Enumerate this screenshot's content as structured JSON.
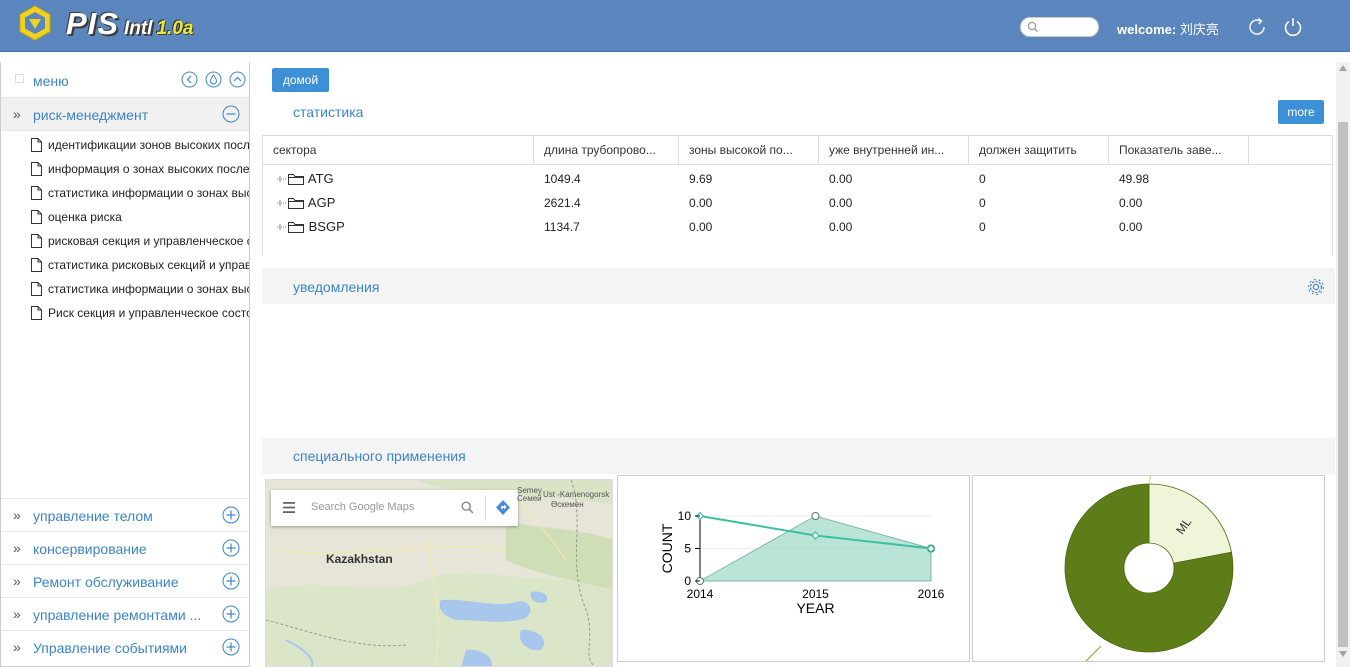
{
  "header": {
    "logo_main": "PIS",
    "logo_sub": "Intl",
    "logo_version": "1.0a",
    "search_placeholder": "",
    "welcome_label": "welcome:",
    "user_name": "刘庆亮",
    "brand_color": "#5b85bd"
  },
  "sidebar": {
    "menu_title": "меню",
    "risk_section": "риск-менеджмент",
    "risk_items": [
      "идентификации зонов высоких последствий",
      "информация о зонах высоких последствий",
      "статистика информации о зонах высоких последствий",
      "оценка риска",
      "рисковая секция и управленческое состояние",
      "статистика рисковых секций и управленческого состояния",
      "статистика информации о зонах высоких последствий",
      "Риск секция и управленческое состояние"
    ],
    "other_sections": [
      "управление телом",
      "консервирование",
      "Ремонт обслуживание",
      "управление ремонтами ...",
      "Управление событиями"
    ]
  },
  "main": {
    "home_button": "домой",
    "stats_title": "статистика",
    "more_button": "more",
    "table": {
      "columns": [
        "сектора",
        "длина трубопрово...",
        "зоны высокой по...",
        "уже внутренней ин...",
        "должен защитить",
        "Показатель заве..."
      ],
      "rows": [
        [
          "ATG",
          "1049.4",
          "9.69",
          "0.00",
          "0",
          "49.98"
        ],
        [
          "AGP",
          "2621.4",
          "0.00",
          "0.00",
          "0",
          "0.00"
        ],
        [
          "BSGP",
          "1134.7",
          "0.00",
          "0.00",
          "0",
          "0.00"
        ]
      ]
    },
    "notifications_title": "уведомления",
    "special_title": "специального применения",
    "map": {
      "search_placeholder": "Search Google Maps",
      "country_label": "Kazakhstan",
      "city_label_1": "Semey",
      "city_label_2": "Ust -Kamenogorsk",
      "city_label_3": "Семей",
      "city_label_4": "Өскемен"
    }
  },
  "chart_data": [
    {
      "type": "area",
      "xlabel": "YEAR",
      "ylabel": "COUNT",
      "x": [
        2014,
        2015,
        2016
      ],
      "ylim": [
        0,
        10
      ],
      "yticks": [
        0,
        5,
        10
      ],
      "series": [
        {
          "values": [
            10,
            7,
            5
          ],
          "color": "#3cbfa0"
        },
        {
          "values": [
            0,
            10,
            5
          ],
          "color": "#9dd9c8"
        }
      ]
    },
    {
      "type": "pie",
      "labels": [
        "",
        "ML"
      ],
      "values": [
        78,
        22
      ],
      "colors": [
        "#5c7d17",
        "#eef5d8"
      ]
    }
  ]
}
